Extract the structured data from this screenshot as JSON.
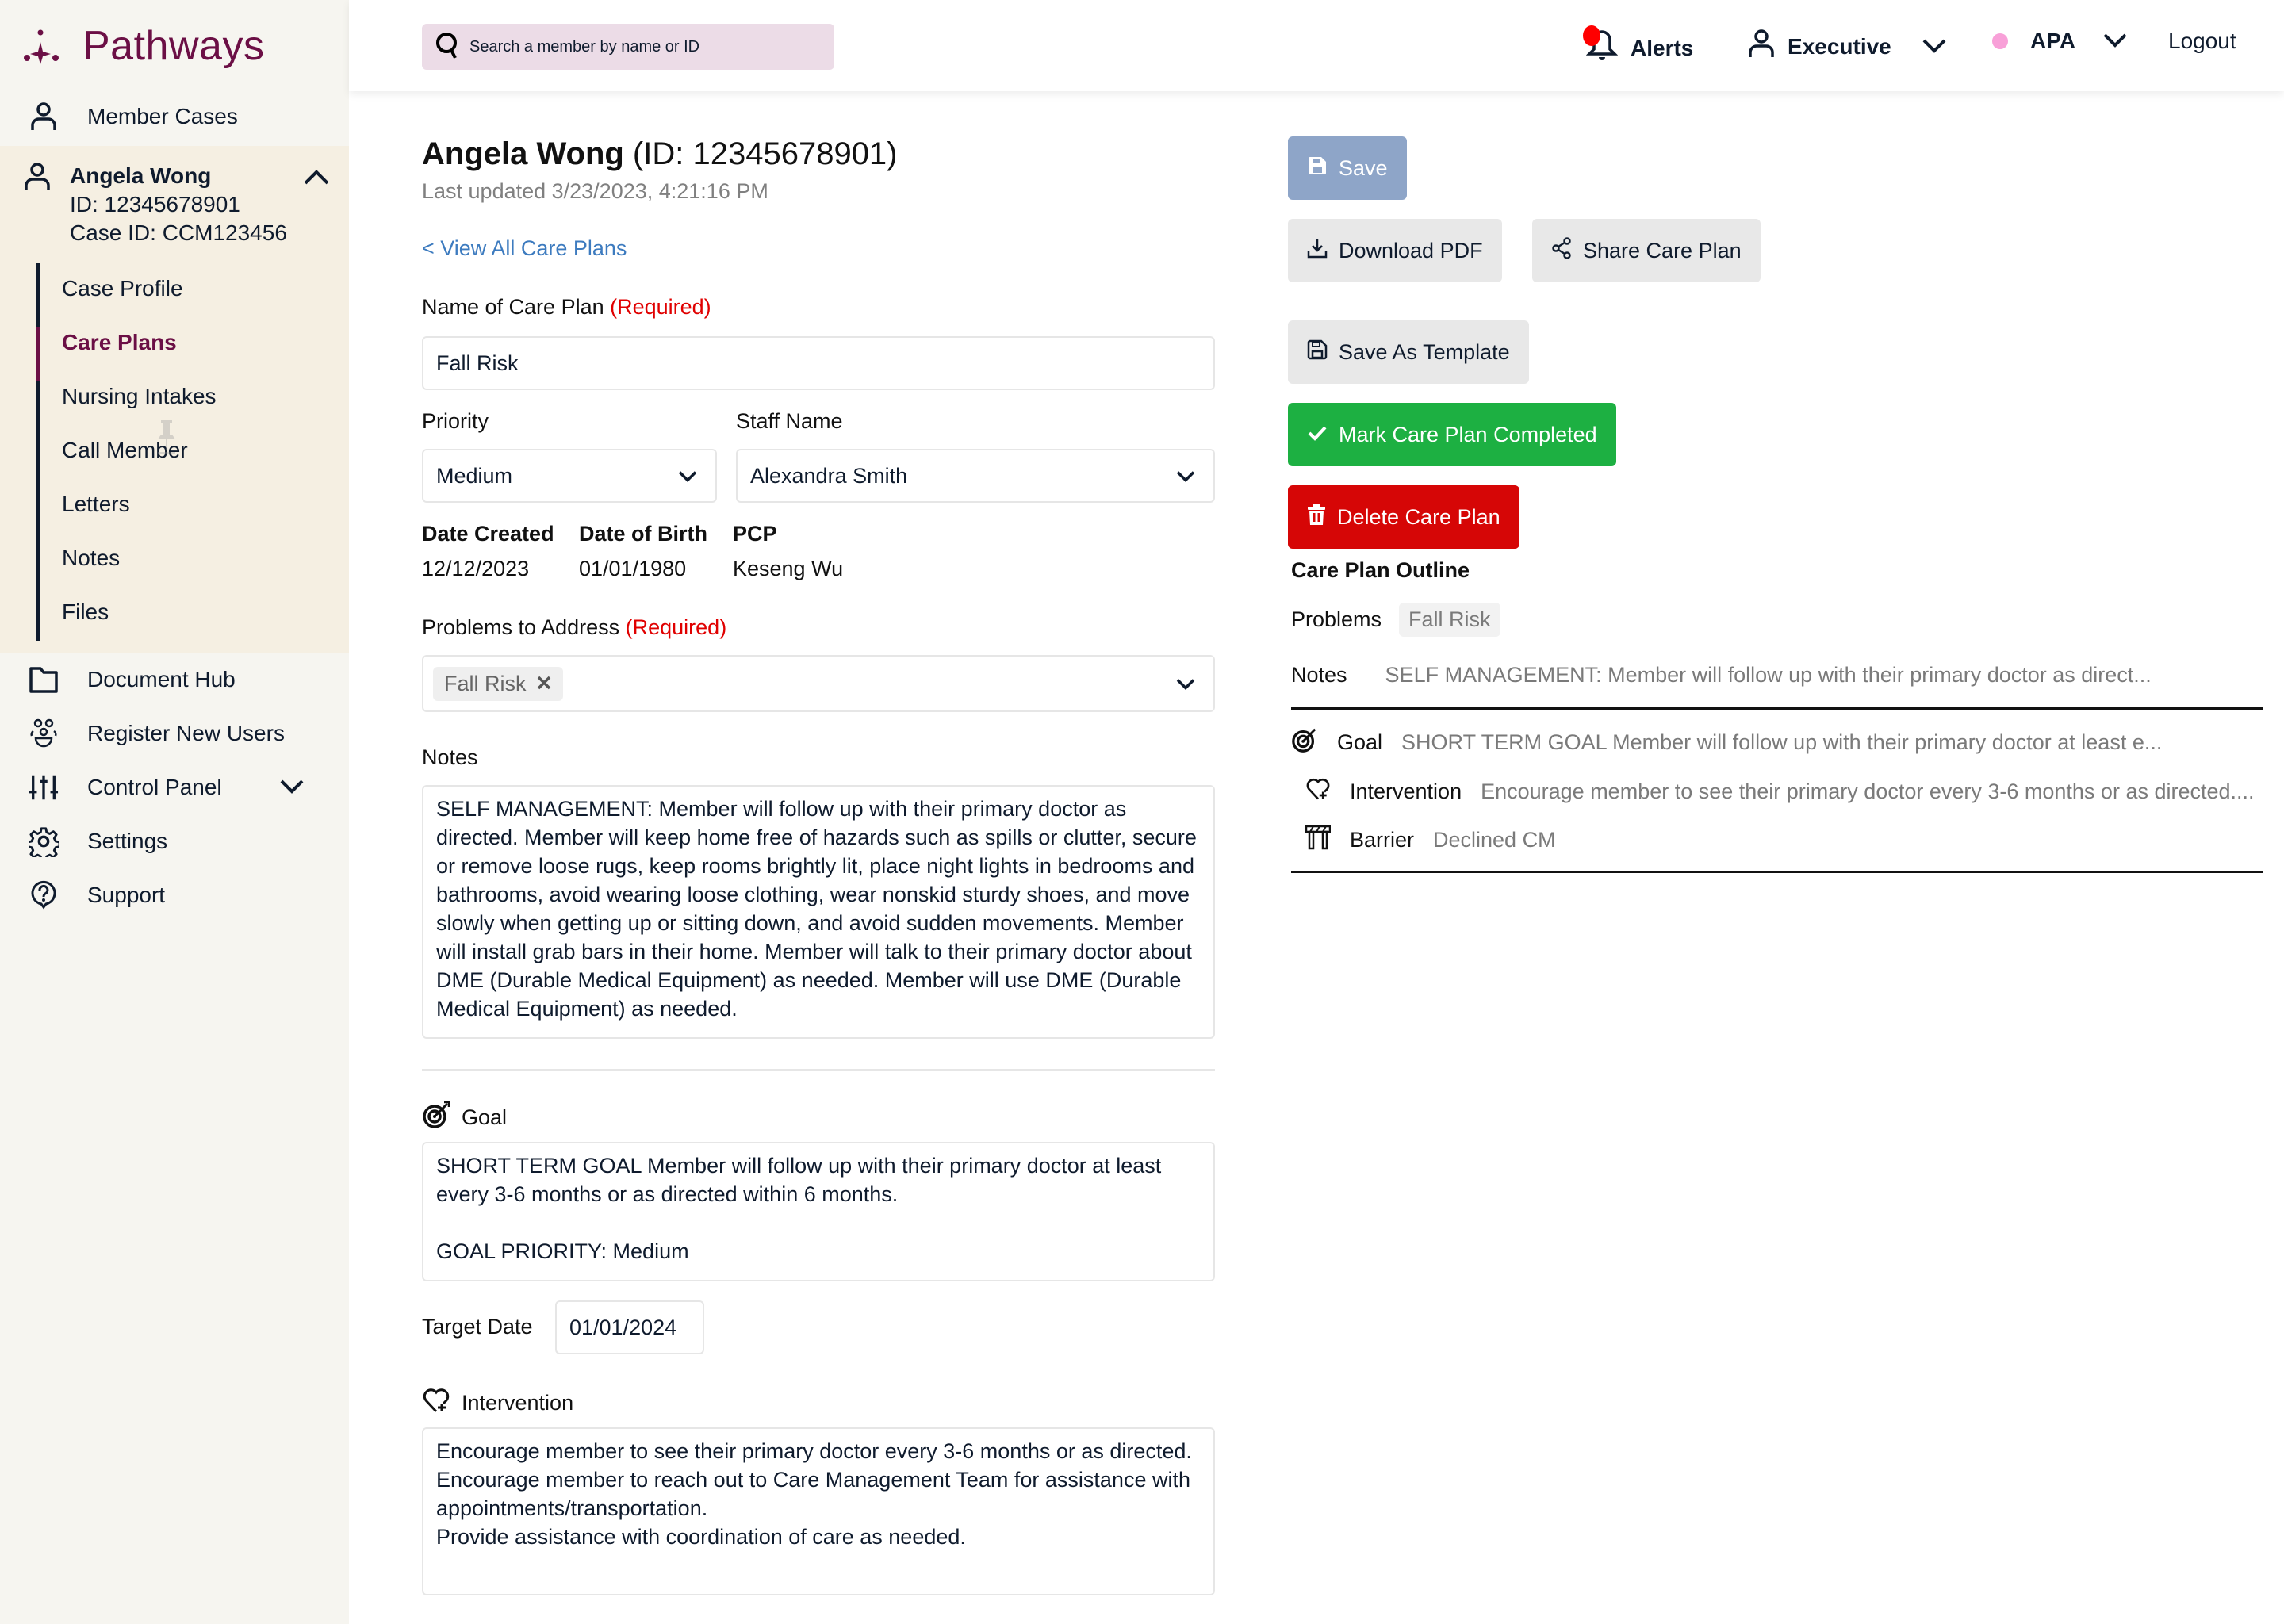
{
  "app": {
    "name": "Pathways",
    "brand_color": "#6b0f45"
  },
  "header": {
    "search_placeholder": "Search a member by name or ID",
    "alerts_label": "Alerts",
    "role_label": "Executive",
    "org_label": "APA",
    "logout_label": "Logout",
    "alert_dot_color": "#ff0000",
    "org_dot_color": "#f8a0d8"
  },
  "sidebar": {
    "member_cases": "Member Cases",
    "member": {
      "name": "Angela Wong",
      "id_line": "ID: 12345678901",
      "case_line": "Case ID: CCM123456"
    },
    "subnav": [
      {
        "label": "Case Profile",
        "active": false
      },
      {
        "label": "Care Plans",
        "active": true
      },
      {
        "label": "Nursing Intakes",
        "active": false
      },
      {
        "label": "Call Member",
        "active": false
      },
      {
        "label": "Letters",
        "active": false
      },
      {
        "label": "Notes",
        "active": false
      },
      {
        "label": "Files",
        "active": false
      }
    ],
    "items": [
      {
        "label": "Document Hub",
        "icon": "folder-icon"
      },
      {
        "label": "Register New Users",
        "icon": "users-icon"
      },
      {
        "label": "Control Panel",
        "icon": "sliders-icon"
      },
      {
        "label": "Settings",
        "icon": "gear-icon"
      },
      {
        "label": "Support",
        "icon": "help-icon"
      }
    ]
  },
  "page": {
    "member_name": "Angela Wong",
    "member_id": " (ID: 12345678901)",
    "last_updated": "Last updated 3/23/2023, 4:21:16 PM",
    "back_link": "< View All Care Plans"
  },
  "form": {
    "required_text": "(Required)",
    "name_label": "Name of Care Plan",
    "name_value": "Fall Risk",
    "priority_label": "Priority",
    "priority_value": "Medium",
    "staff_label": "Staff Name",
    "staff_value": "Alexandra Smith",
    "date_created_label": "Date Created",
    "date_created_value": "12/12/2023",
    "dob_label": "Date of Birth",
    "dob_value": "01/01/1980",
    "pcp_label": "PCP",
    "pcp_value": "Keseng Wu",
    "problems_label": "Problems to Address",
    "problems": [
      "Fall Risk"
    ],
    "notes_label": "Notes",
    "notes_value": "SELF MANAGEMENT: Member will follow up with their primary doctor as directed. Member will keep home free of hazards such as spills or clutter, secure or remove loose rugs, keep rooms brightly lit, place night lights in bedrooms and bathrooms, avoid wearing loose clothing, wear nonskid sturdy shoes, and move slowly when getting up or sitting down, and avoid sudden movements. Member will install grab bars in their home. Member will talk to their primary doctor about DME (Durable Medical Equipment) as needed. Member will use DME (Durable Medical Equipment) as needed.",
    "goal_label": "Goal",
    "goal_value": "SHORT TERM GOAL Member will follow up with their primary doctor at least every 3-6 months or as directed within 6 months.\n\nGOAL PRIORITY: Medium",
    "target_date_label": "Target Date",
    "target_date_value": "01/01/2024",
    "intervention_label": "Intervention",
    "intervention_value": "Encourage member to see their primary doctor every 3-6 months or as directed.\nEncourage member to reach out to Care Management Team for assistance with appointments/transportation.\nProvide assistance with coordination of care as needed."
  },
  "actions": {
    "save": "Save",
    "download_pdf": "Download PDF",
    "share": "Share Care Plan",
    "save_template": "Save As Template",
    "mark_completed": "Mark Care Plan Completed",
    "delete": "Delete Care Plan",
    "colors": {
      "save": "#8ea5c8",
      "complete": "#1db042",
      "delete": "#d60606"
    }
  },
  "outline": {
    "title": "Care Plan Outline",
    "problems_label": "Problems",
    "problems_value": "Fall Risk",
    "notes_label": "Notes",
    "notes_value": "SELF MANAGEMENT: Member will follow up with their primary doctor as direct...",
    "goal_label": "Goal",
    "goal_value": "SHORT TERM GOAL Member will follow up with their primary doctor at least e...",
    "intervention_label": "Intervention",
    "intervention_value": "Encourage member to see their primary doctor every 3-6 months or as directed....",
    "barrier_label": "Barrier",
    "barrier_value": "Declined CM"
  }
}
